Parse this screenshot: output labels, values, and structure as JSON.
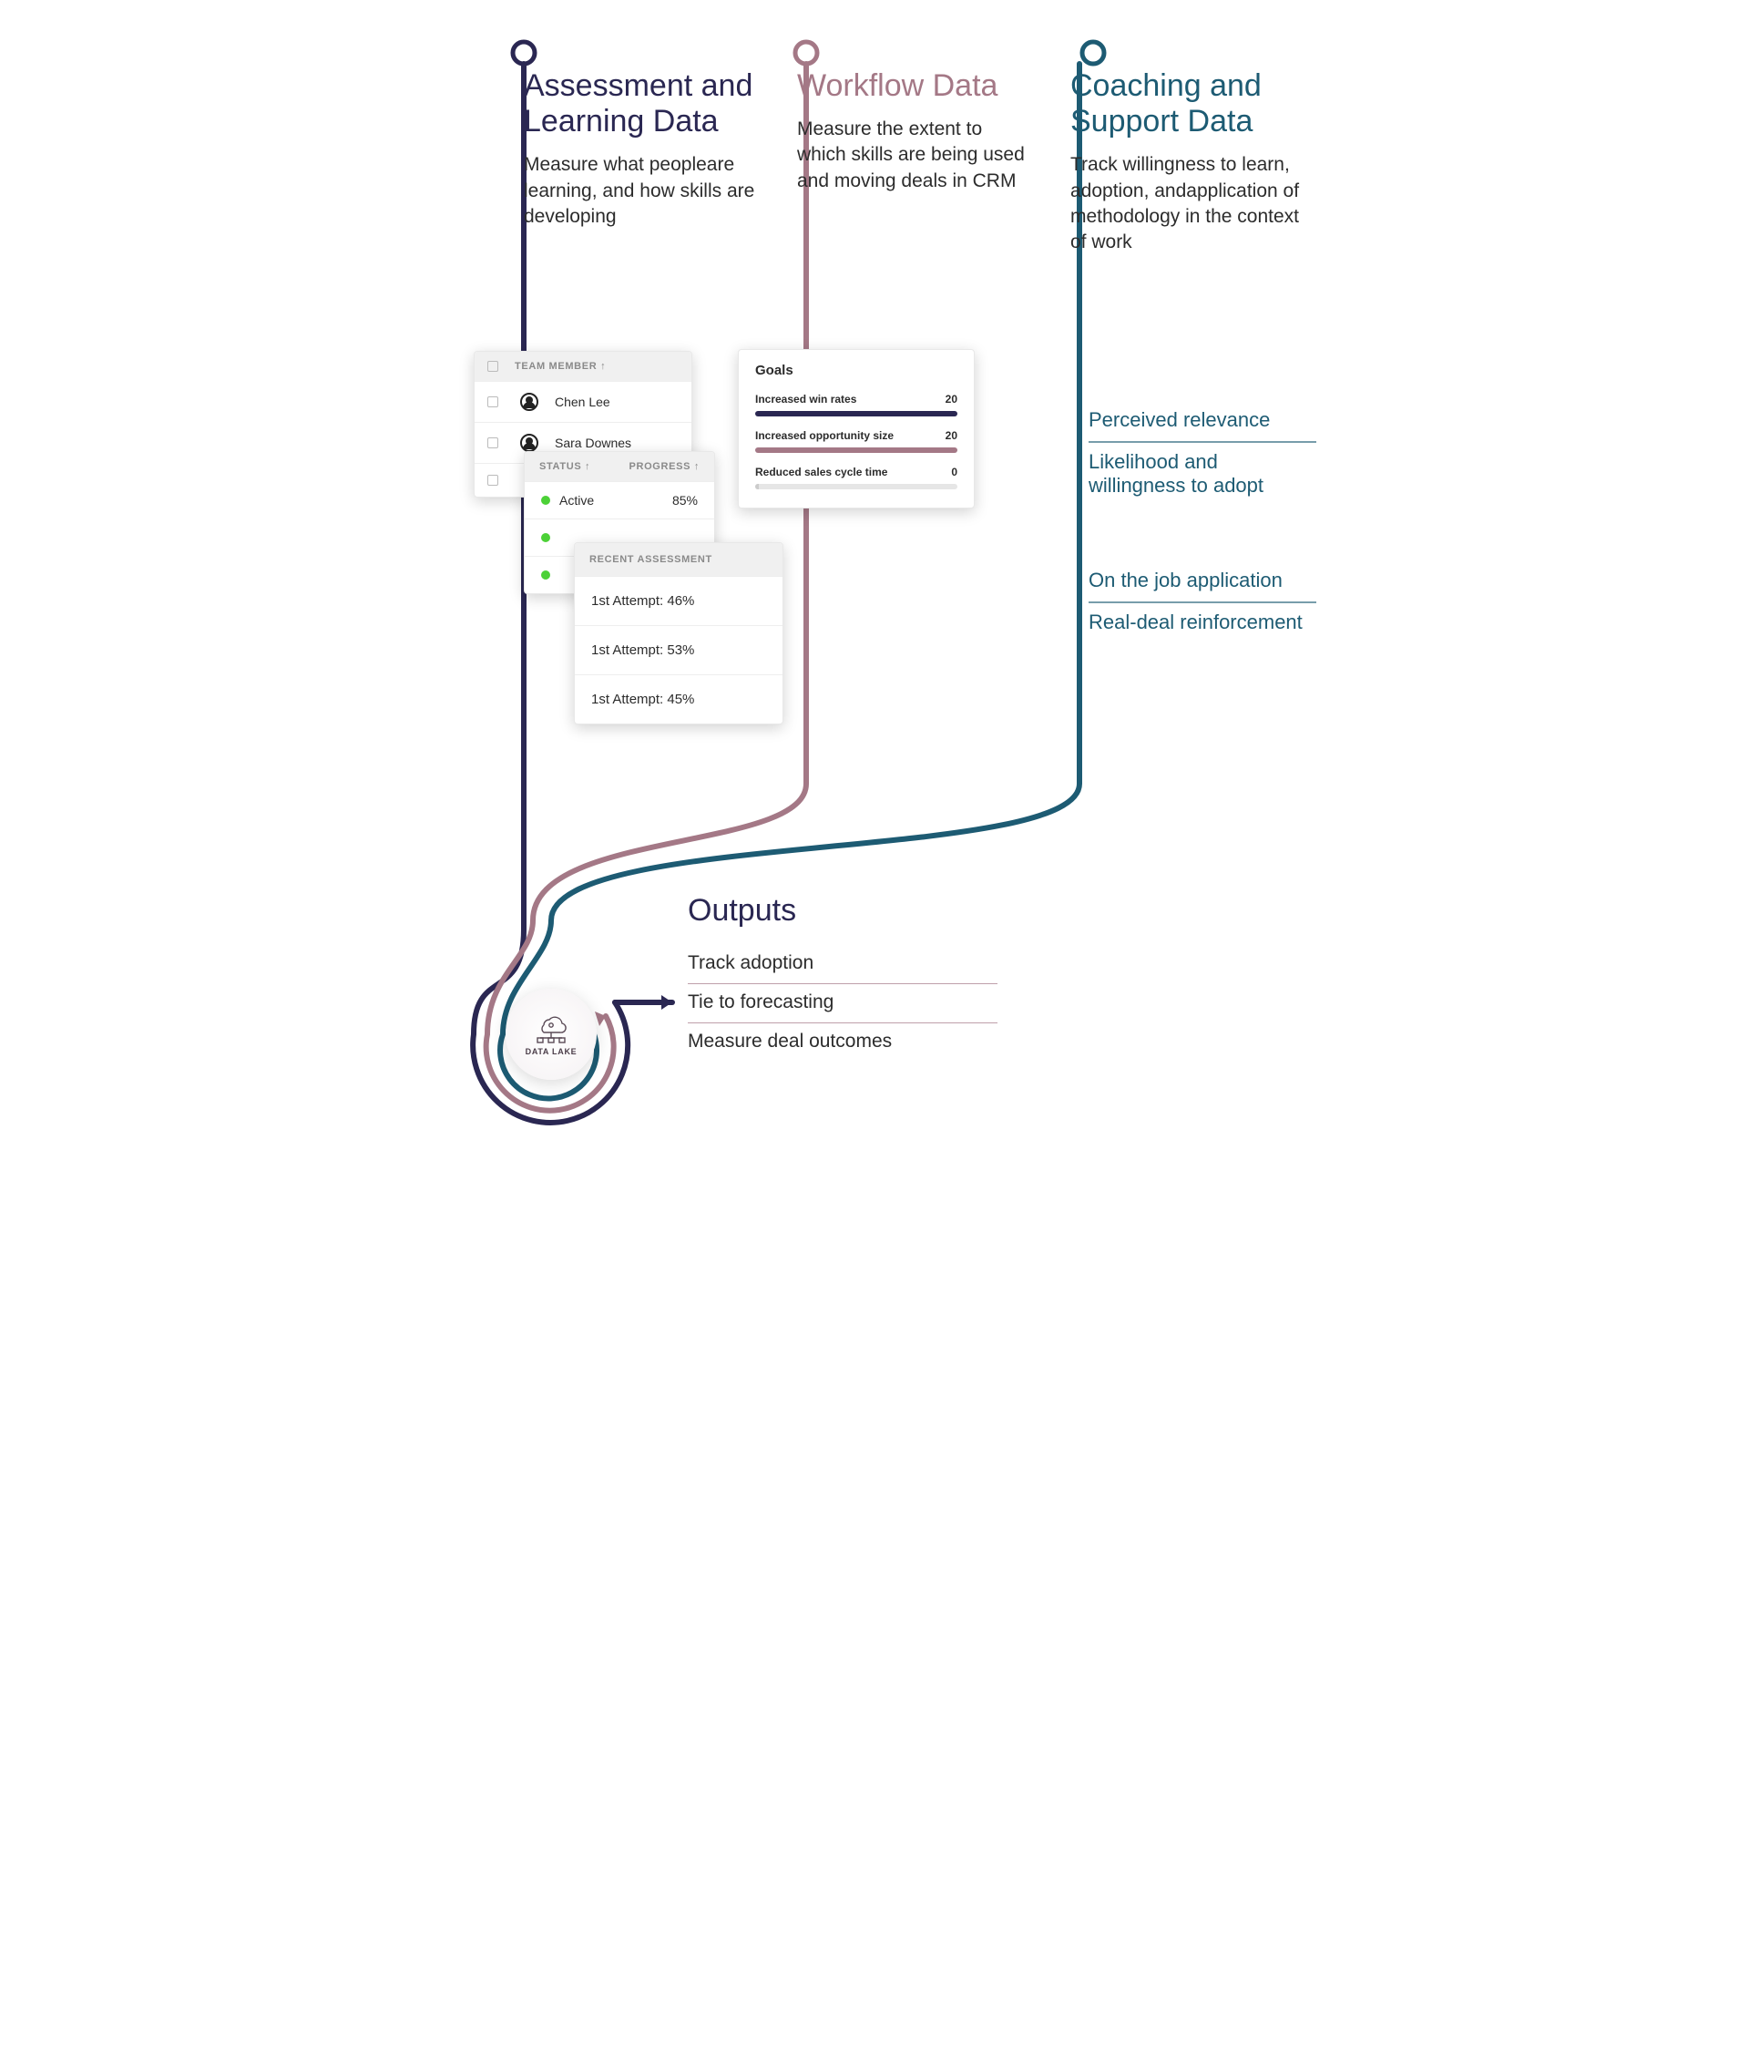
{
  "columns": {
    "assessment": {
      "title": "Assessment and Learning Data",
      "desc": "Measure what peopleare learning, and how skills are developing"
    },
    "workflow": {
      "title": "Workflow Data",
      "desc": "Measure the extent to which skills are being used and moving deals in CRM"
    },
    "coaching": {
      "title": "Coaching and Support Data",
      "desc": "Track willingness to learn, adoption, andapplication of methodology in the context of work"
    }
  },
  "team_card": {
    "header": "TEAM MEMBER ↑",
    "members": [
      "Chen Lee",
      "Sara Downes"
    ]
  },
  "status_card": {
    "header_status": "STATUS ↑",
    "header_progress": "PROGRESS ↑",
    "rows": [
      {
        "status": "Active",
        "progress": "85%"
      }
    ]
  },
  "assessment_card": {
    "header": "RECENT ASSESSMENT",
    "attempts": [
      "1st Attempt: 46%",
      "1st Attempt: 53%",
      "1st Attempt: 45%"
    ]
  },
  "goals_card": {
    "title": "Goals",
    "goals": [
      {
        "label": "Increased win rates",
        "value": "20",
        "pct": 100,
        "color": "#2a2752"
      },
      {
        "label": "Increased opportunity size",
        "value": "20",
        "pct": 100,
        "color": "#a47886"
      },
      {
        "label": "Reduced sales cycle time",
        "value": "0",
        "pct": 2,
        "color": "#cccccc"
      }
    ]
  },
  "coaching_items": [
    "Perceived relevance",
    "Likelihood and willingness to adopt",
    "On the job application",
    "Real-deal reinforcement"
  ],
  "outputs": {
    "title": "Outputs",
    "items": [
      "Track adoption",
      "Tie to forecasting",
      "Measure deal outcomes"
    ]
  },
  "datalake_label": "DATA LAKE",
  "colors": {
    "navy": "#2a2752",
    "mauve": "#a47886",
    "teal": "#1d5b73"
  }
}
